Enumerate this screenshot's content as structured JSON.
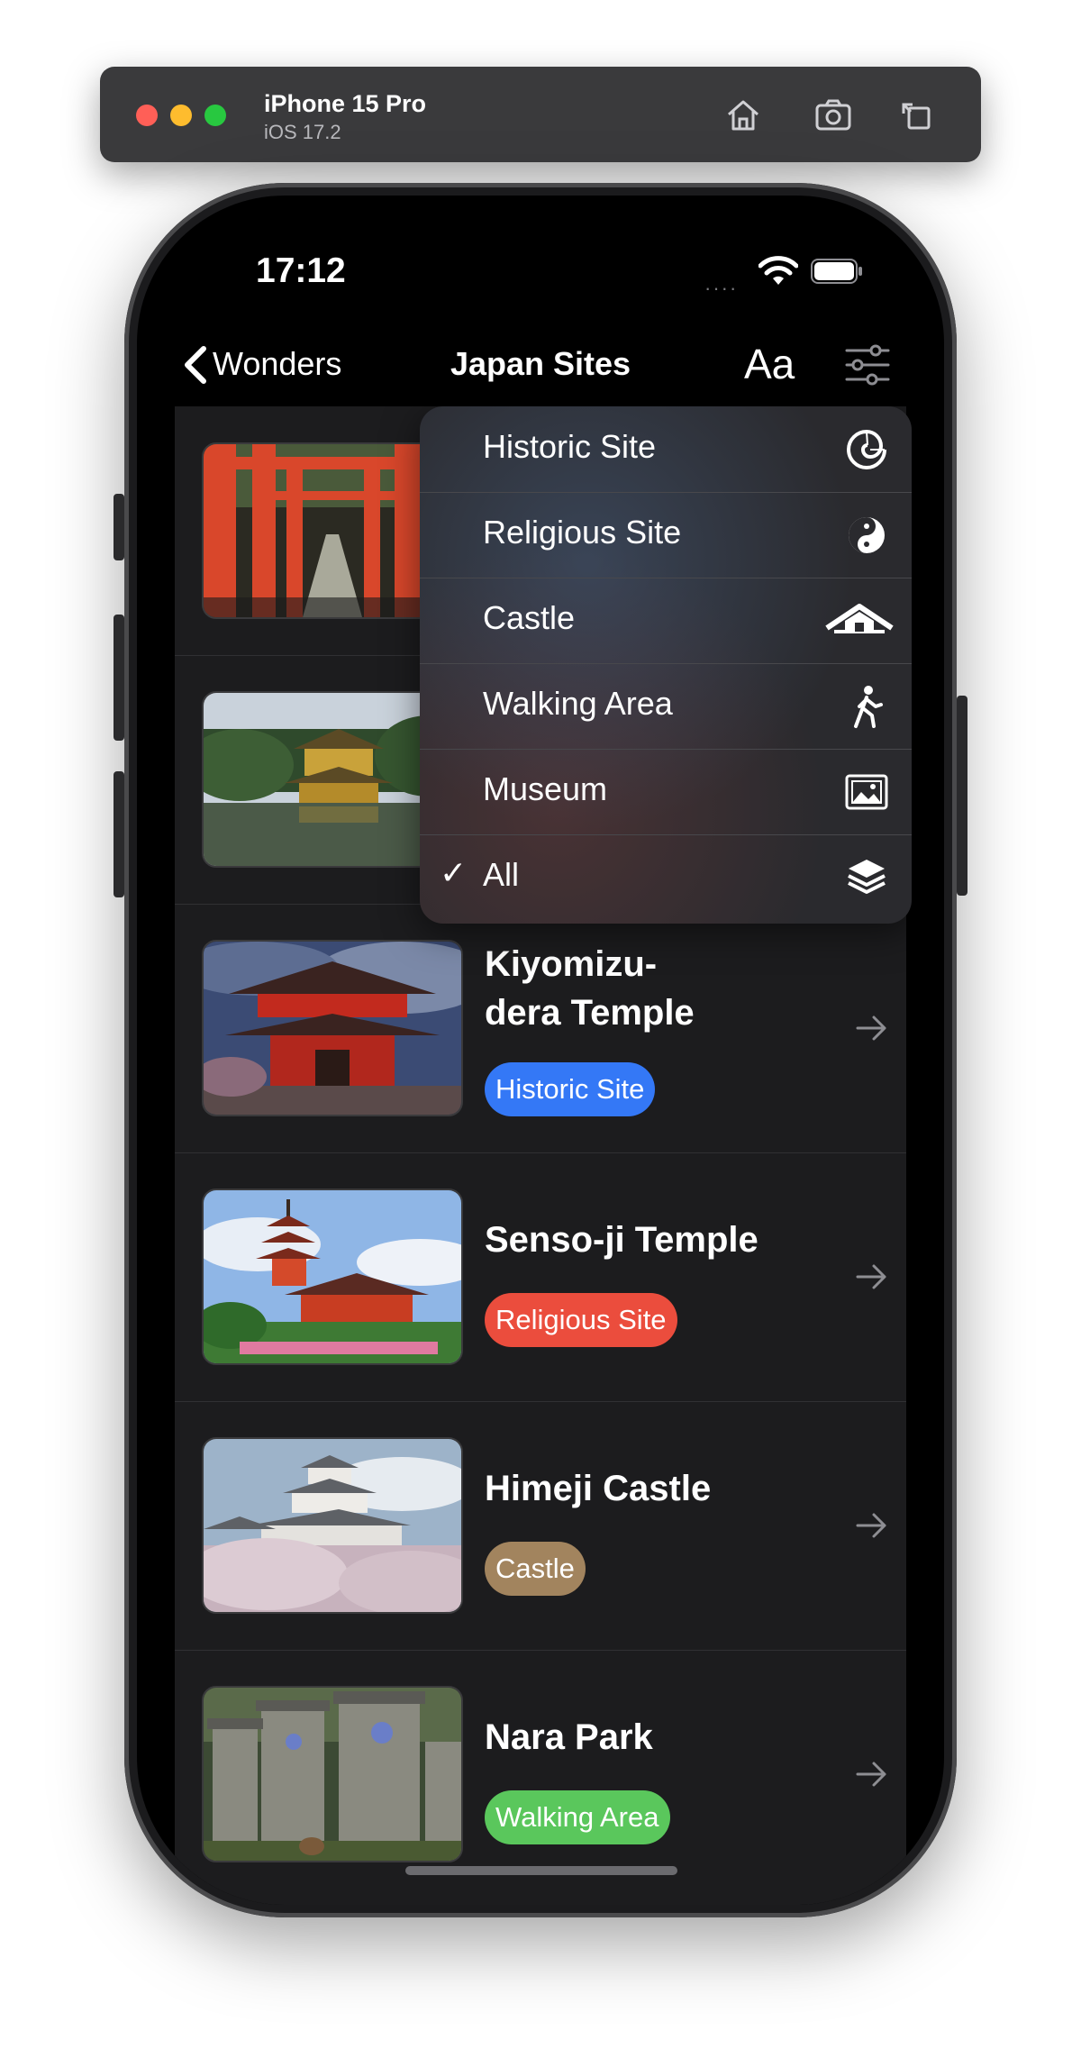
{
  "simulator": {
    "device_name": "iPhone 15 Pro",
    "os_version": "iOS 17.2",
    "buttons": [
      "home-icon",
      "screenshot-icon",
      "rotate-icon"
    ]
  },
  "status_bar": {
    "time": "17:12",
    "signal": "····"
  },
  "nav": {
    "back_label": "Wonders",
    "title": "Japan Sites",
    "text_size_label": "Aa"
  },
  "sites": [
    {
      "name": "",
      "category": "",
      "thumb": "torii-gates"
    },
    {
      "name": "",
      "category": "",
      "thumb": "golden-pavilion"
    },
    {
      "name": "Kiyomizu-\ndera Temple",
      "category": "Historic Site",
      "color": "#3478f6",
      "thumb": "kiyomizu-gate"
    },
    {
      "name": "Senso-ji Temple",
      "category": "Religious Site",
      "color": "#eb4d3d",
      "thumb": "pagoda"
    },
    {
      "name": "Himeji Castle",
      "category": "Castle",
      "color": "#a2845e",
      "thumb": "castle"
    },
    {
      "name": "Nara Park",
      "category": "Walking Area",
      "color": "#5ac75c",
      "thumb": "stone-lanterns"
    }
  ],
  "filter_menu": {
    "items": [
      {
        "label": "Historic Site",
        "icon": "nautilus-icon",
        "selected": false
      },
      {
        "label": "Religious Site",
        "icon": "yin-yang-icon",
        "selected": false
      },
      {
        "label": "Castle",
        "icon": "house-roof-icon",
        "selected": false
      },
      {
        "label": "Walking Area",
        "icon": "walking-person-icon",
        "selected": false
      },
      {
        "label": "Museum",
        "icon": "photo-icon",
        "selected": false
      },
      {
        "label": "All",
        "icon": "layers-icon",
        "selected": true
      }
    ],
    "check_mark": "✓"
  }
}
